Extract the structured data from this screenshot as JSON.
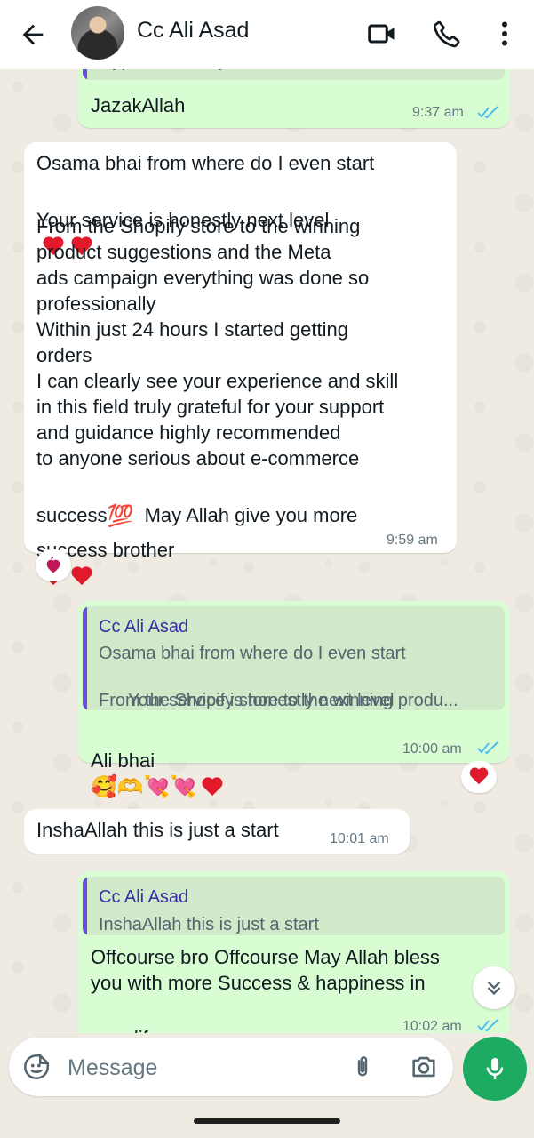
{
  "header": {
    "contact_name": "Cc Ali Asad"
  },
  "messages": {
    "m1": {
      "partial_text": "type kar k bhejta hon",
      "text": "JazakAllah",
      "time": "9:37 am"
    },
    "m2": {
      "lines": [
        "Osama bhai from where do I even start",
        "Your service is honestly next level",
        "From the Shopify store to the winning\nproduct suggestions and the Meta\nads campaign everything was done so\nprofessionally\nWithin just 24 hours I started getting\norders\nI can clearly see your experience and skill\nin this field truly grateful for your support\nand guidance highly recommended\nto anyone serious about e-commerce",
        "success",
        "May Allah give you more",
        "success brother"
      ],
      "time": "9:59 am",
      "hundred_emoji": "💯"
    },
    "m3": {
      "quote_author": "Cc Ali Asad",
      "quote_line1": "Osama bhai from where do I even start",
      "quote_line2": "Your service is honestly next level",
      "quote_line3": "From the Shopify store to the winning produ...",
      "text": "Ali bhai",
      "emojis": "🥰🫶💘💘",
      "time": "10:00 am"
    },
    "m4": {
      "text": "InshaAllah this is just a start",
      "time": "10:01 am"
    },
    "m5": {
      "quote_author": "Cc Ali Asad",
      "quote_text": "InshaAllah this is just a start",
      "text_line1": "Offcourse bro Offcourse May Allah bless",
      "text_line2": "you with more Success & happiness in",
      "text_line3": "your life",
      "time": "10:02 am"
    }
  },
  "composer": {
    "placeholder": "Message"
  },
  "colors": {
    "outgoing_bubble": "#d9fdd3",
    "incoming_bubble": "#ffffff",
    "mic_button": "#1daa61",
    "read_ticks": "#53bdeb",
    "quote_bar": "#6b4ce0"
  },
  "icons": [
    "back-arrow-icon",
    "video-call-icon",
    "phone-icon",
    "more-vert-icon",
    "emoji-icon",
    "attach-icon",
    "camera-icon",
    "mic-icon",
    "double-chevron-down-icon",
    "double-check-icon"
  ]
}
